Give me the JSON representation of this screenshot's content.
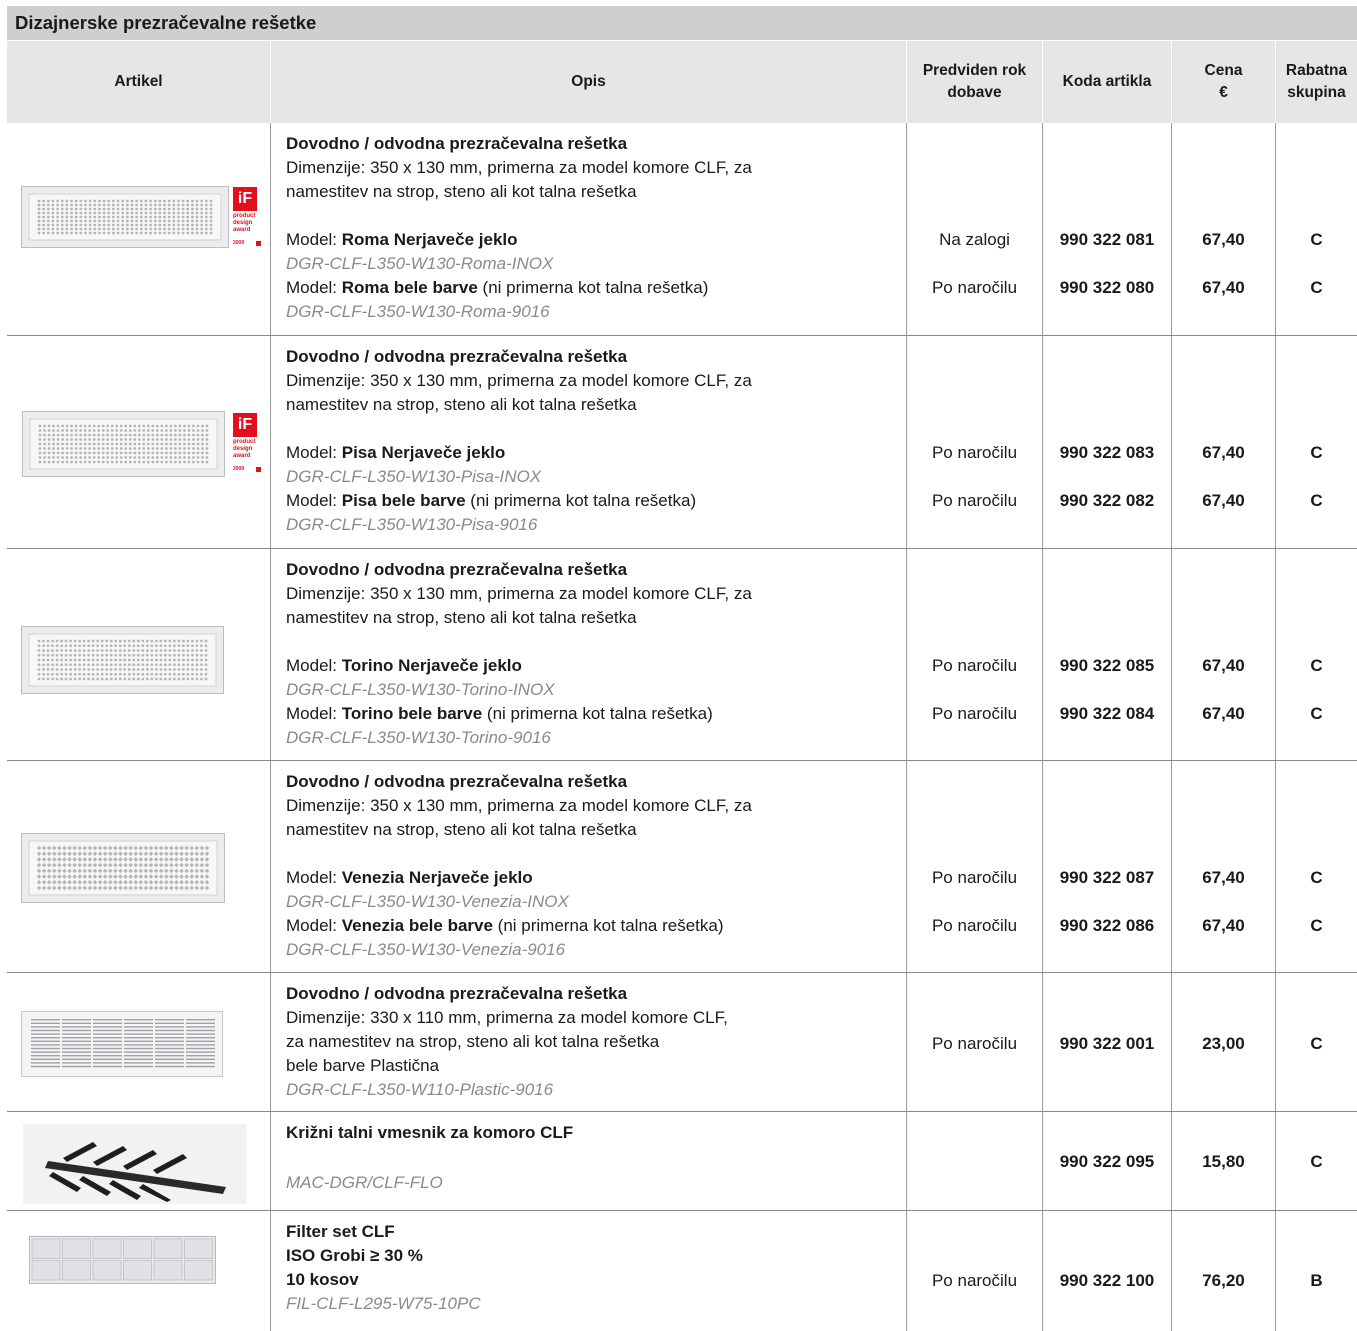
{
  "title": "Dizajnerske prezračevalne rešetke",
  "headers": {
    "artikel": "Artikel",
    "opis": "Opis",
    "rok": "Predviden rok dobave",
    "koda": "Koda artikla",
    "cena": "Cena €",
    "rabat": "Rabatna skupina"
  },
  "award": {
    "logo": "iF",
    "text": "product design award",
    "year": "2009"
  },
  "common": {
    "title": "Dovodno / odvodna prezračevalna rešetka",
    "dim1": "Dimenzije: 350 x 130 mm, primerna za model komore CLF, za",
    "dim2": "namestitev na strop, steno ali kot talna rešetka",
    "model_prefix": "Model: "
  },
  "groups": [
    {
      "image": "grille-roma",
      "m1_name": "Roma Nerjaveče jeklo",
      "m1_note": "",
      "m1_code": "DGR-CLF-L350-W130-Roma-INOX",
      "m1_rok": "Na zalogi",
      "m1_koda": "990 322 081",
      "m1_cena": "67,40",
      "m1_rabat": "C",
      "m2_name": "Roma bele barve",
      "m2_note": " (ni primerna kot talna rešetka)",
      "m2_code": "DGR-CLF-L350-W130-Roma-9016",
      "m2_rok": "Po naročilu",
      "m2_koda": "990 322 080",
      "m2_cena": "67,40",
      "m2_rabat": "C"
    },
    {
      "image": "grille-pisa",
      "m1_name": "Pisa Nerjaveče jeklo",
      "m1_note": "",
      "m1_code": "DGR-CLF-L350-W130-Pisa-INOX",
      "m1_rok": "Po naročilu",
      "m1_koda": "990 322 083",
      "m1_cena": "67,40",
      "m1_rabat": "C",
      "m2_name": "Pisa bele barve",
      "m2_note": " (ni primerna kot talna rešetka)",
      "m2_code": "DGR-CLF-L350-W130-Pisa-9016",
      "m2_rok": "Po naročilu",
      "m2_koda": "990 322 082",
      "m2_cena": "67,40",
      "m2_rabat": "C"
    },
    {
      "image": "grille-torino",
      "m1_name": "Torino Nerjaveče jeklo",
      "m1_note": "",
      "m1_code": "DGR-CLF-L350-W130-Torino-INOX",
      "m1_rok": "Po naročilu",
      "m1_koda": "990 322 085",
      "m1_cena": "67,40",
      "m1_rabat": "C",
      "m2_name": "Torino bele barve",
      "m2_note": " (ni primerna kot talna rešetka)",
      "m2_code": "DGR-CLF-L350-W130-Torino-9016",
      "m2_rok": "Po naročilu",
      "m2_koda": "990 322 084",
      "m2_cena": "67,40",
      "m2_rabat": "C"
    },
    {
      "image": "grille-venezia",
      "m1_name": "Venezia Nerjaveče jeklo",
      "m1_note": "",
      "m1_code": "DGR-CLF-L350-W130-Venezia-INOX",
      "m1_rok": "Po naročilu",
      "m1_koda": "990 322 087",
      "m1_cena": "67,40",
      "m1_rabat": "C",
      "m2_name": "Venezia bele barve",
      "m2_note": " (ni primerna kot talna rešetka)",
      "m2_code": "DGR-CLF-L350-W130-Venezia-9016",
      "m2_rok": "Po naročilu",
      "m2_koda": "990 322 086",
      "m2_cena": "67,40",
      "m2_rabat": "C"
    }
  ],
  "plastic": {
    "title": "Dovodno / odvodna prezračevalna rešetka",
    "line1": "Dimenzije: 330 x 110 mm, primerna za model komore CLF,",
    "line2": "za namestitev na strop, steno ali kot talna rešetka",
    "line3": "bele barve Plastična",
    "code": "DGR-CLF-L350-W110-Plastic-9016",
    "rok": "Po naročilu",
    "koda": "990 322 001",
    "cena": "23,00",
    "rabat": "C"
  },
  "spacer": {
    "title": "Križni talni vmesnik za komoro CLF",
    "code": "MAC-DGR/CLF-FLO",
    "rok": "",
    "koda": "990 322 095",
    "cena": "15,80",
    "rabat": "C"
  },
  "filter": {
    "line1": "Filter set CLF",
    "line2": "ISO Grobi ≥ 30 %",
    "line3": "10 kosov",
    "code": "FIL-CLF-L295-W75-10PC",
    "rok": "Po naročilu",
    "koda": "990 322 100",
    "cena": "76,20",
    "rabat": "B"
  }
}
